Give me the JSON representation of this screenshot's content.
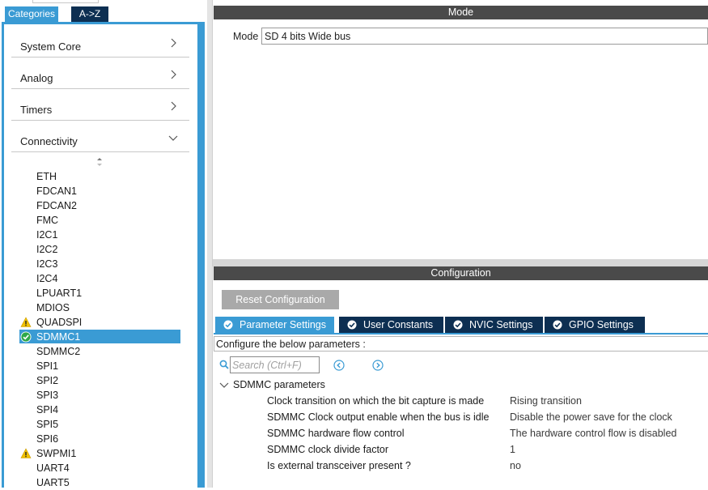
{
  "left_tabs": {
    "categories": "Categories",
    "az": "A->Z"
  },
  "categories": [
    {
      "label": "System Core",
      "state": "collapsed"
    },
    {
      "label": "Analog",
      "state": "collapsed"
    },
    {
      "label": "Timers",
      "state": "collapsed"
    },
    {
      "label": "Connectivity",
      "state": "expanded"
    }
  ],
  "peripherals": [
    {
      "label": "ETH",
      "status": "none"
    },
    {
      "label": "FDCAN1",
      "status": "none"
    },
    {
      "label": "FDCAN2",
      "status": "none"
    },
    {
      "label": "FMC",
      "status": "none"
    },
    {
      "label": "I2C1",
      "status": "none"
    },
    {
      "label": "I2C2",
      "status": "none"
    },
    {
      "label": "I2C3",
      "status": "none"
    },
    {
      "label": "I2C4",
      "status": "none"
    },
    {
      "label": "LPUART1",
      "status": "none"
    },
    {
      "label": "MDIOS",
      "status": "none"
    },
    {
      "label": "QUADSPI",
      "status": "warning"
    },
    {
      "label": "SDMMC1",
      "status": "enabled",
      "selected": true
    },
    {
      "label": "SDMMC2",
      "status": "none"
    },
    {
      "label": "SPI1",
      "status": "none"
    },
    {
      "label": "SPI2",
      "status": "none"
    },
    {
      "label": "SPI3",
      "status": "none"
    },
    {
      "label": "SPI4",
      "status": "none"
    },
    {
      "label": "SPI5",
      "status": "none"
    },
    {
      "label": "SPI6",
      "status": "none"
    },
    {
      "label": "SWPMI1",
      "status": "warning"
    },
    {
      "label": "UART4",
      "status": "none"
    },
    {
      "label": "UART5",
      "status": "none"
    }
  ],
  "mode": {
    "section_title": "Mode",
    "label": "Mode",
    "value": "SD 4 bits Wide bus"
  },
  "configuration": {
    "section_title": "Configuration",
    "reset_label": "Reset Configuration",
    "tabs": [
      {
        "label": "Parameter Settings",
        "active": true
      },
      {
        "label": "User Constants",
        "active": false
      },
      {
        "label": "NVIC Settings",
        "active": false
      },
      {
        "label": "GPIO Settings",
        "active": false
      }
    ],
    "description": "Configure the below parameters :",
    "search_placeholder": "Search (Ctrl+F)",
    "group_label": "SDMMC parameters",
    "params": [
      {
        "name": "Clock transition on which the bit capture is made",
        "value": "Rising transition"
      },
      {
        "name": "SDMMC Clock output enable when the bus is idle",
        "value": "Disable the power save for the clock"
      },
      {
        "name": "SDMMC hardware flow control",
        "value": "The hardware control flow is disabled"
      },
      {
        "name": "SDMMC clock divide factor",
        "value": "1"
      },
      {
        "name": "Is external transceiver present ?",
        "value": "no"
      }
    ]
  },
  "colors": {
    "accent": "#3a9bd4",
    "dark_navy": "#0d2f52",
    "section_bar": "#4a4a4a",
    "warning": "#f2c200",
    "enabled": "#2ea84a"
  }
}
